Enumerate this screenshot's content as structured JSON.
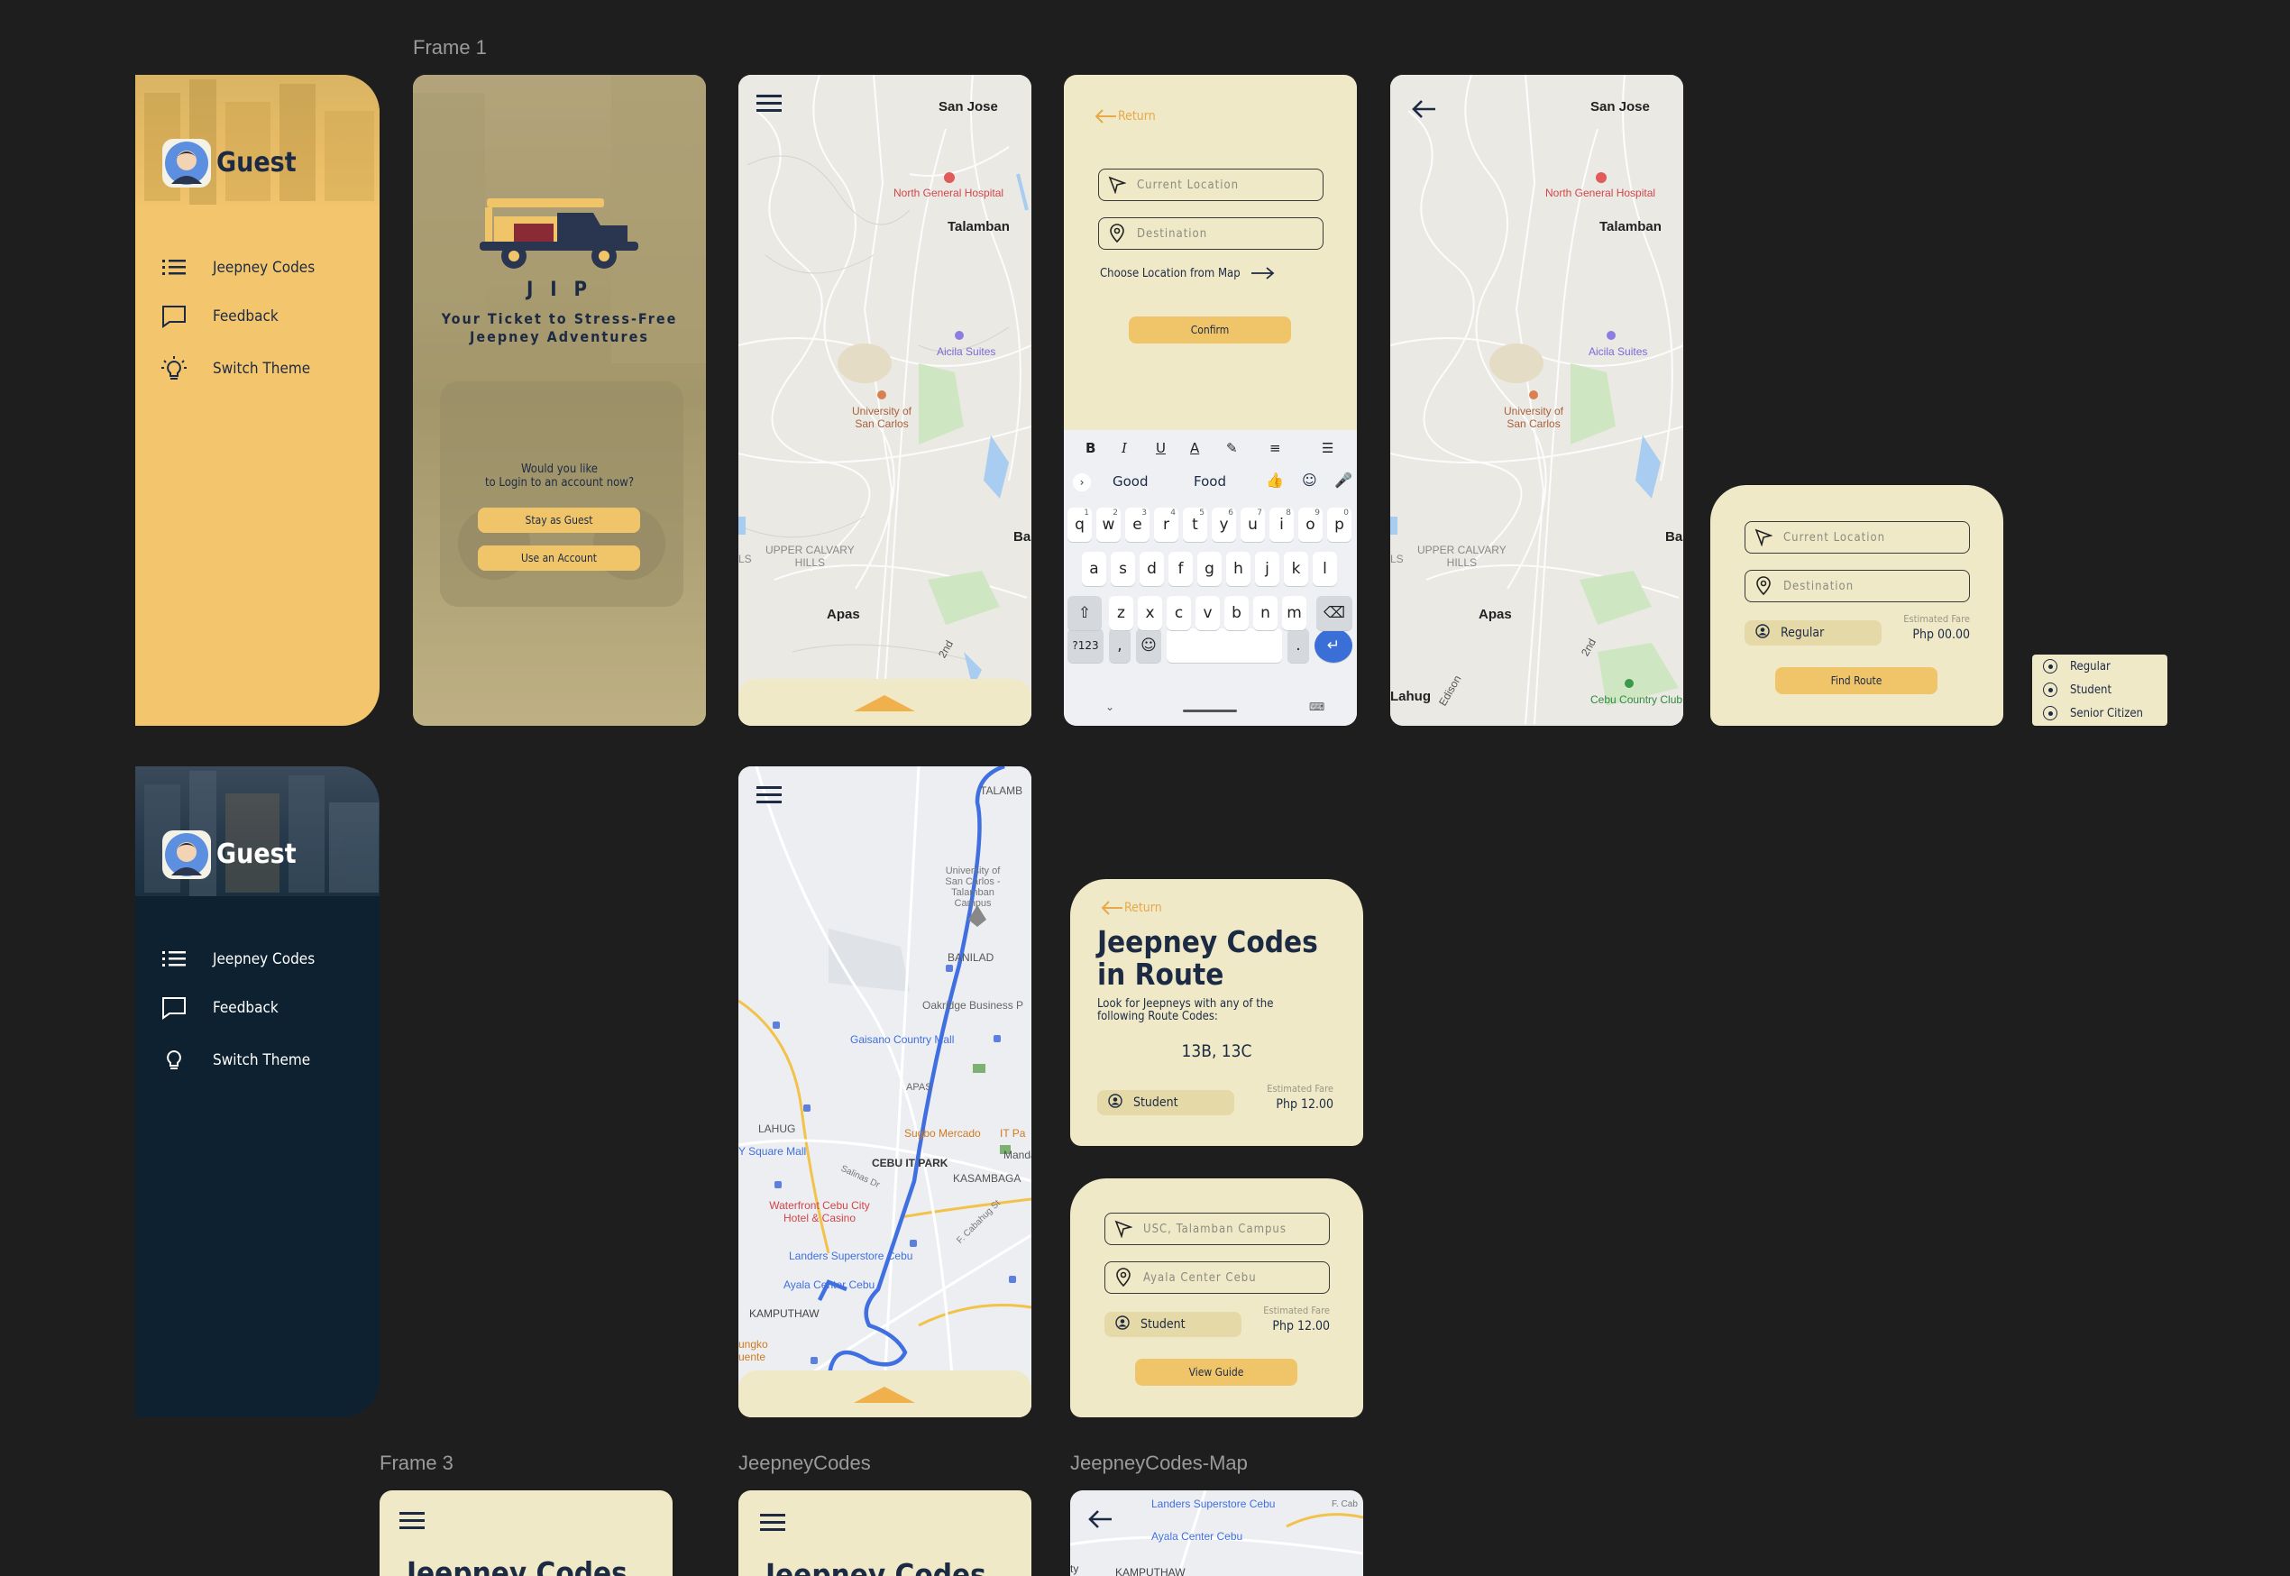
{
  "frames": {
    "frame1": "Frame 1",
    "frame3": "Frame 3",
    "jeepney_codes": "JeepneyCodes",
    "jeepney_codes_map": "JeepneyCodes-Map"
  },
  "drawer": {
    "guest": "Guest",
    "items": [
      {
        "label": "Jeepney Codes",
        "icon": "list-icon"
      },
      {
        "label": "Feedback",
        "icon": "chat-bubble-icon"
      },
      {
        "label": "Switch Theme",
        "icon": "lightbulb-icon"
      }
    ]
  },
  "splash": {
    "logo_text": "J I P",
    "tagline_1": "Your Ticket to Stress-Free",
    "tagline_2": "Jeepney Adventures",
    "question_1": "Would you like",
    "question_2": "to Login to an account now?",
    "stay_guest": "Stay as Guest",
    "use_account": "Use an Account"
  },
  "map": {
    "san_jose": "San Jose",
    "hospital": "North General Hospital",
    "talamban": "Talamban",
    "aicila": "Aicila Suites",
    "usc_1": "University of",
    "usc_2": "San Carlos",
    "calvary_1": "UPPER CALVARY",
    "calvary_2": "HILLS",
    "apas": "Apas",
    "second": "2nd",
    "ba": "Ba",
    "lahug": "Lahug",
    "edison": "Edison",
    "country_club": "Cebu Country Club",
    "ls": "LS"
  },
  "search": {
    "return": "Return",
    "current_location": "Current Location",
    "destination": "Destination",
    "choose_map": "Choose Location from Map",
    "confirm": "Confirm"
  },
  "keyboard": {
    "suggest_1": "Good",
    "suggest_2": "Food",
    "row1": [
      "q",
      "w",
      "e",
      "r",
      "t",
      "y",
      "u",
      "i",
      "o",
      "p"
    ],
    "row1_nums": [
      "1",
      "2",
      "3",
      "4",
      "5",
      "6",
      "7",
      "8",
      "9",
      "0"
    ],
    "row2": [
      "a",
      "s",
      "d",
      "f",
      "g",
      "h",
      "j",
      "k",
      "l"
    ],
    "row3": [
      "z",
      "x",
      "c",
      "v",
      "b",
      "n",
      "m"
    ],
    "sym": "?123",
    "comma": ",",
    "period": "."
  },
  "route_panel": {
    "current_location": "Current Location",
    "destination": "Destination",
    "passenger": "Regular",
    "fare_label": "Estimated Fare",
    "fare_value": "Php 00.00",
    "find_route": "Find Route"
  },
  "passenger_options": [
    "Regular",
    "Student",
    "Senior Citizen"
  ],
  "route_map": {
    "talamb": "TALAMB",
    "usc": "University of San Carlos - Talamban Campus",
    "banilad": "BANILAD",
    "oakridge": "Oakridge Business P",
    "gaisano": "Gaisano Country Mall",
    "apas": "APAS",
    "lahug": "LAHUG",
    "sugbo": "Sugbo Mercado",
    "it_park": "IT Pa",
    "sky_square": "Y Square Mall",
    "cebu_it_park": "CEBU IT PARK",
    "mandaue": "Mandaue",
    "kasambagan": "KASAMBAGA",
    "waterfront": "Waterfront Cebu City Hotel & Casino",
    "landers": "Landers Superstore Cebu",
    "ayala": "Ayala Center Cebu",
    "kamputhaw": "KAMPUTHAW",
    "ungko": "ungko",
    "uente": "uente",
    "salinas": "Salinas Dr",
    "cabahug": "F. Cabahug St"
  },
  "codes": {
    "return": "Return",
    "title_1": "Jeepney Codes",
    "title_2": "in Route",
    "subtitle_1": "Look for Jeepneys with any of the",
    "subtitle_2": "following Route Codes:",
    "codes": "13B, 13C",
    "passenger": "Student",
    "fare_label": "Estimated Fare",
    "fare_value": "Php 12.00"
  },
  "guide": {
    "from": "USC, Talamban Campus",
    "to": "Ayala Center Cebu",
    "passenger": "Student",
    "fare_label": "Estimated Fare",
    "fare_value": "Php 12.00",
    "view_guide": "View Guide"
  },
  "bottom": {
    "title_partial": "Jeepney Codes",
    "map_landers": "Landers Superstore Cebu",
    "map_ayala": "Ayala Center Cebu",
    "map_kamputhaw": "KAMPUTHAW",
    "map_ty": "ty",
    "map_fcab": "F. Cab"
  },
  "colors": {
    "bg": "#1e1e1e",
    "yellow": "#f0c56a",
    "cream": "#efe9c8",
    "navy": "#1d2a44",
    "dark_teal": "#0d2130",
    "route_blue": "#3f6fe0",
    "accent_orange": "#e8a948"
  }
}
